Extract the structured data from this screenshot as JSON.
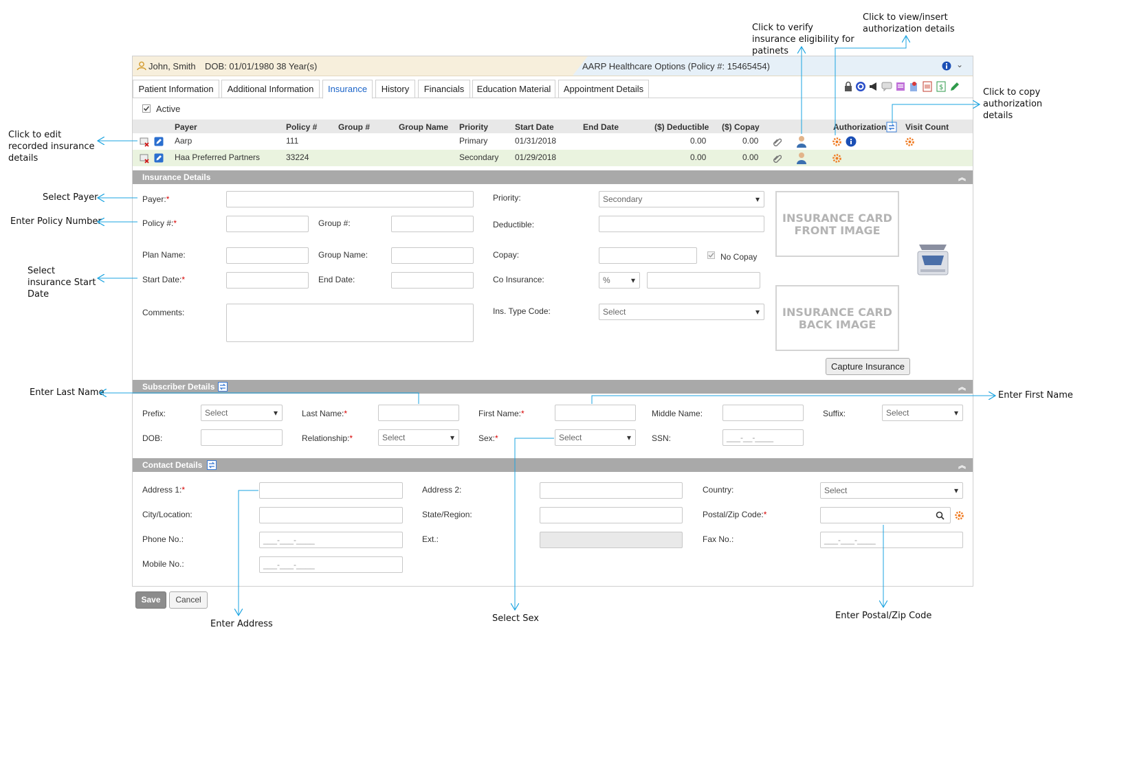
{
  "annotations": {
    "verify": "Click to verify insurance eligibility for patinets",
    "authorization": "Click to view/insert authorization details",
    "copy": "Click to copy authorization details",
    "edit": "Click to edit recorded insurance details",
    "payer": "Select Payer",
    "policy": "Enter Policy Number",
    "start": "Select insurance Start Date",
    "last_name": "Enter Last Name",
    "first_name": "Enter First Name",
    "address": "Enter Address",
    "sex": "Select Sex",
    "postal": "Enter Postal/Zip Code"
  },
  "patient": {
    "name": "John, Smith",
    "dob": "DOB: 01/01/1980 38 Year(s)",
    "policy_info": "AARP Healthcare Options (Policy #: 15465454)"
  },
  "tabs": [
    "Patient Information",
    "Additional Information",
    "Insurance",
    "History",
    "Financials",
    "Education Material",
    "Appointment Details"
  ],
  "active_label": "Active",
  "grid": {
    "headers": [
      "Payer",
      "Policy #",
      "Group #",
      "Group Name",
      "Priority",
      "Start Date",
      "End Date",
      "($) Deductible",
      "($) Copay",
      "Authorization",
      "Visit Count"
    ],
    "rows": [
      {
        "payer": "Aarp",
        "policy": "111",
        "priority": "Primary",
        "start": "01/31/2018",
        "deductible": "0.00",
        "copay": "0.00"
      },
      {
        "payer": "Haa Preferred Partners",
        "policy": "33224",
        "priority": "Secondary",
        "start": "01/29/2018",
        "deductible": "0.00",
        "copay": "0.00"
      }
    ]
  },
  "insurance_details": {
    "title": "Insurance Details",
    "payer": "Payer:",
    "policy": "Policy #:",
    "group_no": "Group #:",
    "plan_name": "Plan Name:",
    "group_name": "Group Name:",
    "start_date": "Start Date:",
    "end_date": "End Date:",
    "comments": "Comments:",
    "priority": "Priority:",
    "priority_value": "Secondary",
    "deductible": "Deductible:",
    "copay": "Copay:",
    "no_copay": "No Copay",
    "co_insurance": "Co Insurance:",
    "co_insurance_unit": "%",
    "ins_type_code": "Ins. Type Code:",
    "ins_type_value": "Select",
    "front_image": "INSURANCE CARD FRONT IMAGE",
    "back_image": "INSURANCE CARD BACK IMAGE",
    "capture": "Capture Insurance"
  },
  "subscriber": {
    "title": "Subscriber Details",
    "prefix": "Prefix:",
    "last_name": "Last Name:",
    "first_name": "First Name:",
    "middle_name": "Middle Name:",
    "suffix": "Suffix:",
    "dob": "DOB:",
    "relationship": "Relationship:",
    "sex": "Sex:",
    "ssn": "SSN:",
    "select": "Select",
    "ssn_mask": "___-__-____"
  },
  "contact": {
    "title": "Contact Details",
    "address1": "Address 1:",
    "address2": "Address 2:",
    "country": "Country:",
    "city": "City/Location:",
    "state": "State/Region:",
    "postal": "Postal/Zip Code:",
    "phone": "Phone No.:",
    "ext": "Ext.:",
    "fax": "Fax No.:",
    "mobile": "Mobile No.:",
    "select": "Select",
    "phone_mask": "___-___-____"
  },
  "buttons": {
    "save": "Save",
    "cancel": "Cancel"
  }
}
